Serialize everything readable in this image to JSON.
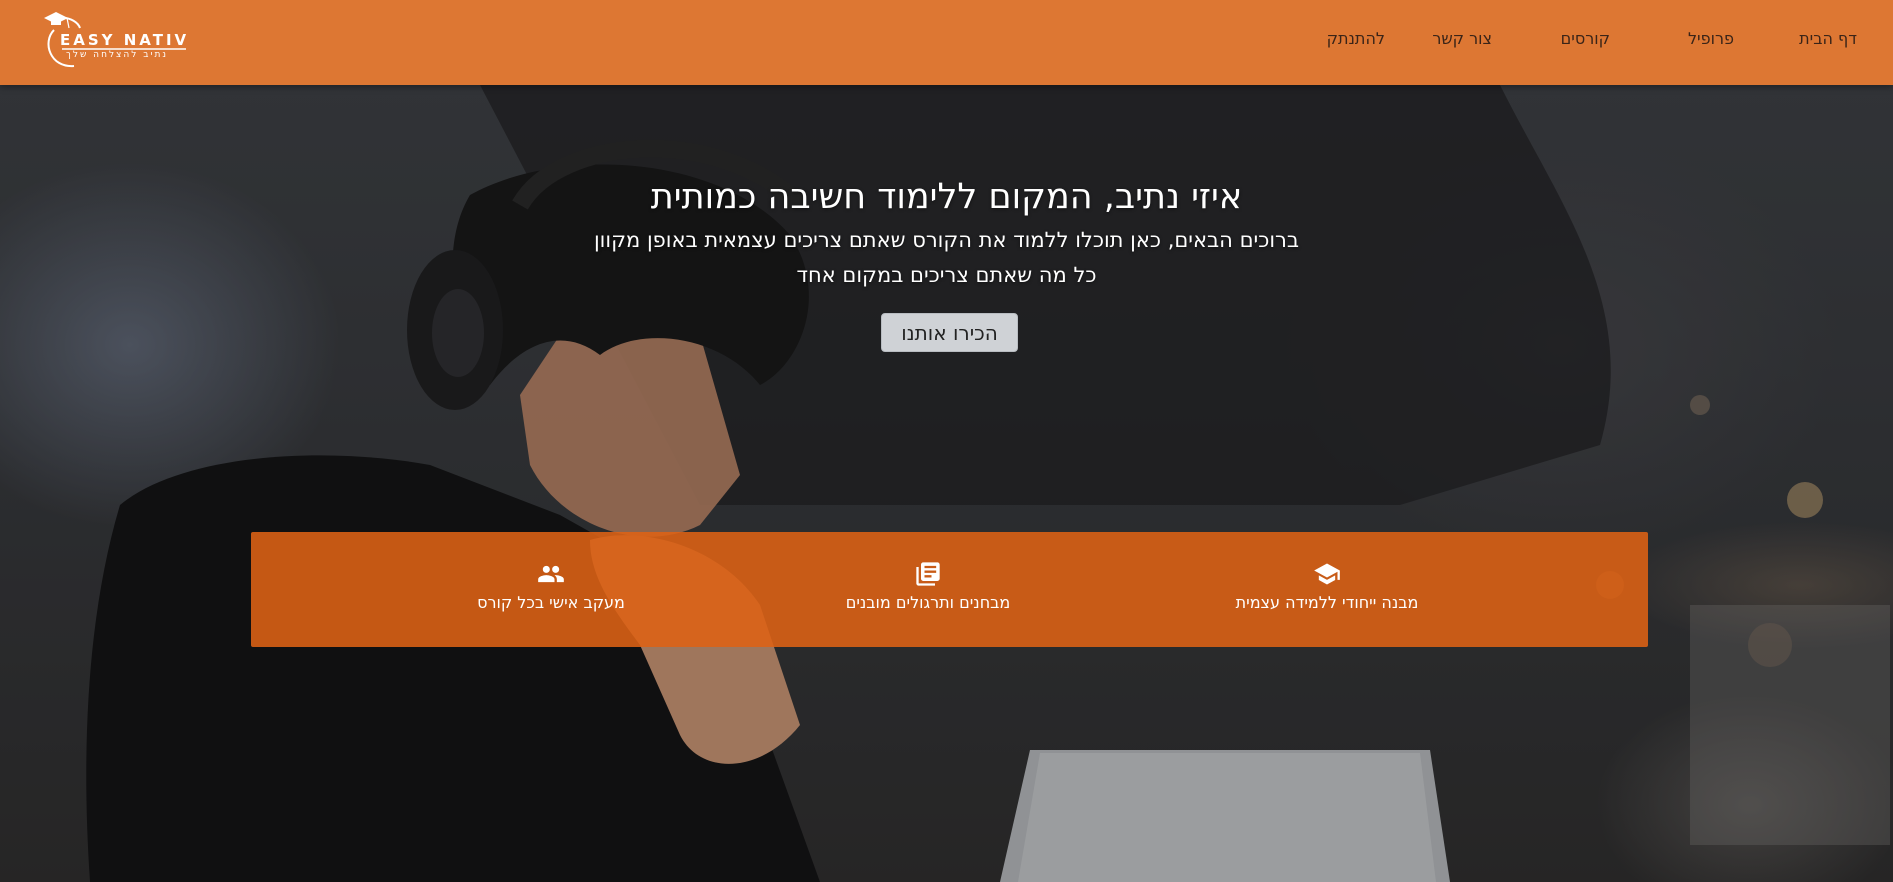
{
  "header": {
    "logo": {
      "brand": "EASY NATIV",
      "tagline": "נתיב להצלחה שלך"
    },
    "nav": [
      {
        "label": "דף הבית"
      },
      {
        "label": "פרופיל"
      },
      {
        "label": "קורסים"
      },
      {
        "label": "צור קשר"
      },
      {
        "label": "להתנתק"
      }
    ],
    "bar_color": "#dd7733"
  },
  "hero": {
    "title": "איזי נתיב, המקום ללימוד חשיבה כמותית",
    "subtitle": "ברוכים הבאים, כאן תוכלו ללמוד את הקורס שאתם צריכים עצמאית באופן מקוון",
    "subtitle2": "כל מה שאתם צריכים במקום אחד",
    "cta_label": "הכירו אותנו"
  },
  "features": [
    {
      "icon": "graduation-cap-icon",
      "label": "מבנה ייחודי ללמידה עצמית"
    },
    {
      "icon": "library-books-icon",
      "label": "מבחנים ותרגולים מובנים"
    },
    {
      "icon": "people-icon",
      "label": "מעקב אישי בכל קורס"
    }
  ],
  "colors": {
    "accent": "#dd7733",
    "band": "#de6214",
    "button": "#cfd2d6"
  }
}
